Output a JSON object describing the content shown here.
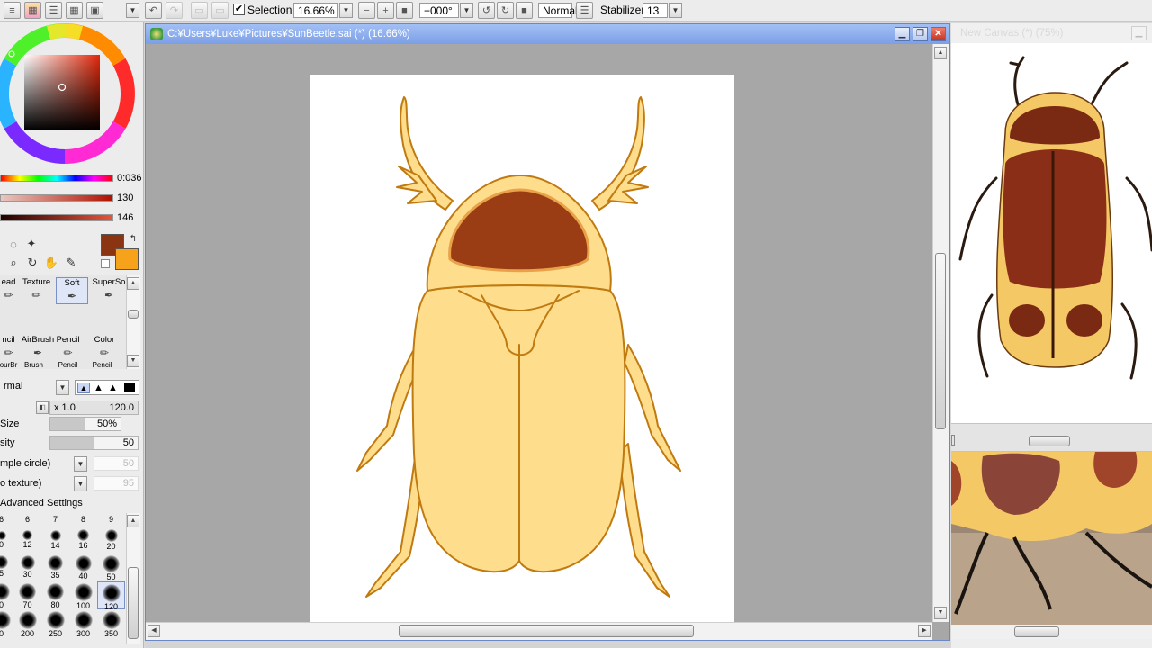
{
  "toolbar": {
    "selection_label": "Selection",
    "selection_checked": "✔",
    "zoom": "16.66%",
    "rotation": "+000°",
    "blend_mode": "Normal",
    "stabilizer_label": "Stabilizer",
    "stabilizer_value": "13"
  },
  "color_panel": {
    "slider_values": [
      "0:036",
      "130",
      "146"
    ],
    "primary_color": "#8b3412",
    "secondary_color": "#f6a21a"
  },
  "brushes": {
    "row1": [
      "ead",
      "Texture",
      "Soft",
      "SuperSo"
    ],
    "row2": [
      "ncil",
      "AirBrush",
      "Pencil",
      "Color"
    ],
    "row3": [
      "ourBr",
      "Brush",
      "Pencil",
      "Pencil"
    ],
    "selected": "Soft"
  },
  "brush_settings": {
    "mode": "rmal",
    "size_multiplier": "x 1.0",
    "size_max": "120.0",
    "size_label": "Size",
    "size_value": "50%",
    "density_label": "sity",
    "density_value": "50",
    "shape": "mple circle)",
    "shape_value": "50",
    "texture": "o texture)",
    "texture_value": "95",
    "advanced_label": "Advanced Settings"
  },
  "brush_sizes": {
    "header": [
      "6",
      "6",
      "7",
      "8",
      "9"
    ],
    "rows": [
      [
        "0",
        "12",
        "14",
        "16",
        "20"
      ],
      [
        "5",
        "30",
        "35",
        "40",
        "50"
      ],
      [
        "0",
        "70",
        "80",
        "100",
        "120"
      ],
      [
        "0",
        "200",
        "250",
        "300",
        "350"
      ]
    ],
    "selected": "120"
  },
  "canvas": {
    "title": "C:¥Users¥Luke¥Pictures¥SunBeetle.sai (*) (16.66%)"
  },
  "reference": {
    "title": "New Canvas (*) (75%)"
  },
  "colors": {
    "beetle_body": "#fedd8c",
    "beetle_outline": "#c07a10",
    "beetle_head_patch": "#9a3d14",
    "canvas_bg": "#a7a7a7",
    "title_bar": "#7b9fe6"
  }
}
